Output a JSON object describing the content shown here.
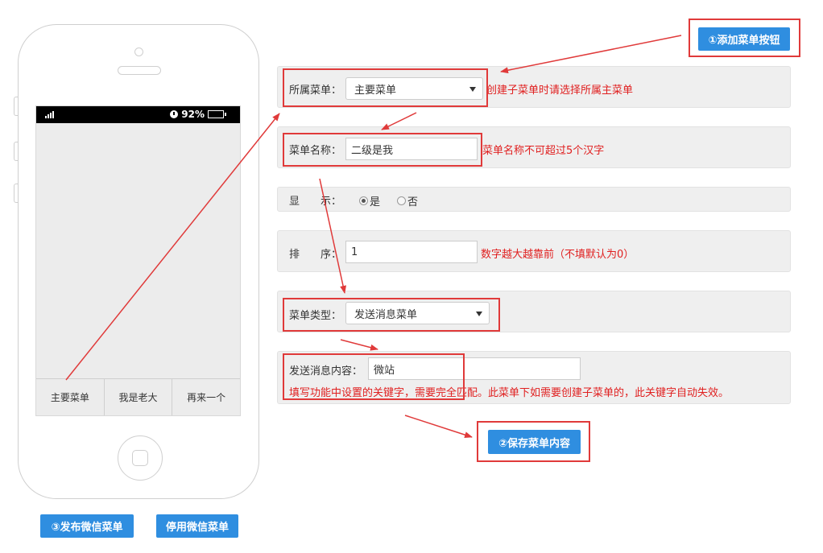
{
  "phone": {
    "battery": "92%",
    "menu_items": [
      "主要菜单",
      "我是老大",
      "再来一个"
    ]
  },
  "buttons": {
    "add_menu": "①添加菜单按钮",
    "save_menu": "②保存菜单内容",
    "publish_menu": "③发布微信菜单",
    "disable_menu": "停用微信菜单"
  },
  "form": {
    "parent_menu": {
      "label": "所属菜单：",
      "value": "主要菜单",
      "hint": "创建子菜单时请选择所属主菜单"
    },
    "menu_name": {
      "label": "菜单名称：",
      "value": "二级是我",
      "hint": "菜单名称不可超过5个汉字"
    },
    "display": {
      "label": "显　　示：",
      "option_yes": "是",
      "option_no": "否",
      "selected": "是"
    },
    "order": {
      "label": "排　　序：",
      "value": "1",
      "hint": "数字越大越靠前（不填默认为0）"
    },
    "menu_type": {
      "label": "菜单类型：",
      "value": "发送消息菜单"
    },
    "message_content": {
      "label": "发送消息内容：",
      "value": "微站",
      "hint": "填写功能中设置的关键字，需要完全匹配。此菜单下如需要创建子菜单的，此关键字自动失效。"
    }
  },
  "colors": {
    "accent": "#2f8ee0",
    "hint": "#e02020",
    "annotation": "#e03a3a"
  }
}
